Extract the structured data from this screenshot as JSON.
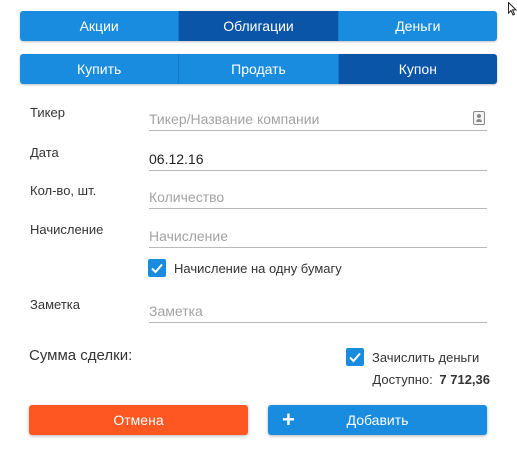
{
  "instrument_tabs": [
    {
      "label": "Акции",
      "active": false
    },
    {
      "label": "Облигации",
      "active": true
    },
    {
      "label": "Деньги",
      "active": false
    }
  ],
  "action_tabs": [
    {
      "label": "Купить",
      "active": false
    },
    {
      "label": "Продать",
      "active": false
    },
    {
      "label": "Купон",
      "active": true
    }
  ],
  "form": {
    "ticker": {
      "label": "Тикер",
      "value": "",
      "placeholder": "Тикер/Название компании"
    },
    "date": {
      "label": "Дата",
      "value": "06.12.16",
      "placeholder": ""
    },
    "quantity": {
      "label": "Кол-во, шт.",
      "value": "",
      "placeholder": "Количество"
    },
    "accrual": {
      "label": "Начисление",
      "value": "",
      "placeholder": "Начисление"
    },
    "per_bond": {
      "label": "Начисление на одну бумагу",
      "checked": true
    },
    "note": {
      "label": "Заметка",
      "value": "",
      "placeholder": "Заметка"
    }
  },
  "summary": {
    "sum_label": "Сумма сделки:",
    "credit_money": {
      "label": "Зачислить деньги",
      "checked": true
    },
    "available_label": "Доступно:",
    "available_amount": "7 712,36"
  },
  "buttons": {
    "cancel_label": "Отмена",
    "add_label": "Добавить",
    "add_icon": "+"
  },
  "colors": {
    "accent": "#1a8ce0",
    "active_tab": "#0b55a8",
    "cancel": "#ff5722"
  }
}
